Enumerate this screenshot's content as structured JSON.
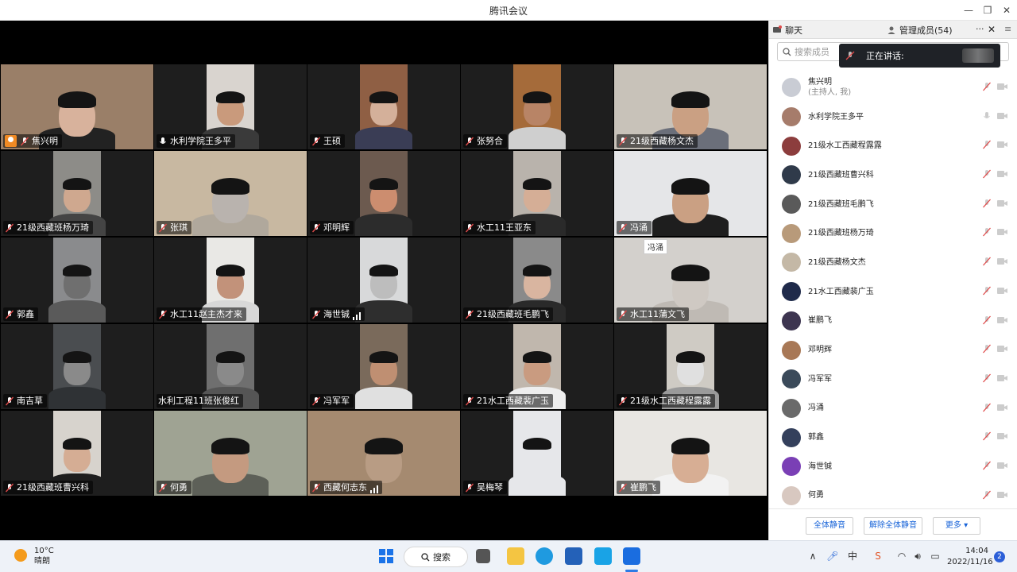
{
  "window": {
    "title": "腾讯会议"
  },
  "tiles": [
    {
      "name": "焦兴明",
      "host": true,
      "mic": "muted",
      "bg": "#9a7f68",
      "pic_l": 0,
      "pic_w": 192,
      "skin": "#d8b29c",
      "cloth": "#222"
    },
    {
      "name": "水利学院王多平",
      "mic": "on",
      "bg": "#d9d4cf",
      "pic_l": 66,
      "pic_w": 60,
      "skin": "#c99a7c",
      "cloth": "#3a3a3a"
    },
    {
      "name": "王硕",
      "mic": "muted",
      "bg": "#8f5f44",
      "pic_l": 66,
      "pic_w": 60,
      "skin": "#d4b09a",
      "cloth": "#3a3d55"
    },
    {
      "name": "张努合",
      "mic": "muted",
      "bg": "#a56b3a",
      "pic_l": 66,
      "pic_w": 60,
      "skin": "#b88466",
      "cloth": "#cfcfcf"
    },
    {
      "name": "21级西藏杨文杰",
      "mic": "muted",
      "bg": "#c8c2b9",
      "pic_l": 0,
      "pic_w": 192,
      "skin": "#caa083",
      "cloth": "#6b6f7a"
    },
    {
      "name": "21级西藏班杨万琦",
      "mic": "muted",
      "bg": "#8d8c88",
      "pic_l": 66,
      "pic_w": 60,
      "skin": "#cfa88f",
      "cloth": "#444"
    },
    {
      "name": "张琪",
      "mic": "muted",
      "bg": "#c8b8a1",
      "pic_l": 0,
      "pic_w": 192,
      "skin": "#b9b3ae",
      "cloth": "#b0a89c"
    },
    {
      "name": "邓明辉",
      "mic": "muted",
      "bg": "#6c5a4f",
      "pic_l": 66,
      "pic_w": 60,
      "skin": "#cc8d6f",
      "cloth": "#2c2c2c"
    },
    {
      "name": "水工11王亚东",
      "mic": "muted",
      "bg": "#b9b3ac",
      "pic_l": 66,
      "pic_w": 60,
      "skin": "#d5ae96",
      "cloth": "#2a2a2a"
    },
    {
      "name": "冯涌",
      "mic": "muted",
      "bg": "#e5e6e8",
      "pic_l": 0,
      "pic_w": 192,
      "skin": "#caa083",
      "cloth": "#1e1e1e"
    },
    {
      "name": "郭鑫",
      "mic": "muted",
      "bg": "#8a8b8d",
      "pic_l": 66,
      "pic_w": 60,
      "skin": "#6f6f6f",
      "cloth": "#5a5a5a"
    },
    {
      "name": "水工11赵主杰才来",
      "mic": "muted",
      "bg": "#e9e8e5",
      "pic_l": 66,
      "pic_w": 60,
      "skin": "#c2927a",
      "cloth": "#d8d8d8"
    },
    {
      "name": "海世铖",
      "mic": "muted",
      "bg": "#d8d9da",
      "pic_l": 66,
      "pic_w": 60,
      "skin": "#bdbdbd",
      "cloth": "#2e2e2e",
      "signal": true
    },
    {
      "name": "21级西藏班毛鹏飞",
      "mic": "muted",
      "bg": "#8a8a8a",
      "pic_l": 66,
      "pic_w": 60,
      "skin": "#d9b5a0",
      "cloth": "#2a2a2a"
    },
    {
      "name": "水工11蒲文飞",
      "mic": "muted",
      "bg": "#d3d0cc",
      "pic_l": 0,
      "pic_w": 192,
      "skin": "#cfc9c3",
      "cloth": "#bfbab4"
    },
    {
      "name": "南吉草",
      "mic": "muted",
      "bg": "#4a4d50",
      "pic_l": 66,
      "pic_w": 60,
      "skin": "#8a8a8a",
      "cloth": "#2f3235"
    },
    {
      "name": "水利工程11班张俊红",
      "mic": "none",
      "bg": "#6f6f6f",
      "pic_l": 66,
      "pic_w": 60,
      "skin": "#8a8a8a",
      "cloth": "#555"
    },
    {
      "name": "冯军军",
      "mic": "muted",
      "bg": "#7a6a5b",
      "pic_l": 66,
      "pic_w": 60,
      "skin": "#bf8f72",
      "cloth": "#e0e0e0"
    },
    {
      "name": "21水工西藏裴广玉",
      "mic": "muted",
      "bg": "#c0b7ad",
      "pic_l": 66,
      "pic_w": 60,
      "skin": "#c99b80",
      "cloth": "#eeeeee"
    },
    {
      "name": "21级水工西藏程露露",
      "mic": "muted",
      "bg": "#cfcbc4",
      "pic_l": 66,
      "pic_w": 60,
      "skin": "#e0e0e0",
      "cloth": "#9a9a9a"
    },
    {
      "name": "21级西藏班曹兴科",
      "mic": "muted",
      "bg": "#d7d3cd",
      "pic_l": 66,
      "pic_w": 60,
      "skin": "#d5ad94",
      "cloth": "#1e1e1e"
    },
    {
      "name": "何勇",
      "mic": "muted",
      "bg": "#9fa393",
      "pic_l": 0,
      "pic_w": 192,
      "skin": "#c49a80",
      "cloth": "#5d6058"
    },
    {
      "name": "西藏何志东",
      "mic": "muted",
      "bg": "#a58a70",
      "pic_l": 0,
      "pic_w": 192,
      "skin": "#b89c84",
      "cloth": "#a58a70",
      "signal": true
    },
    {
      "name": "吴梅琴",
      "mic": "muted",
      "bg": "#e6e7ea",
      "pic_l": 66,
      "pic_w": 60,
      "skin": "#e6e7ea",
      "cloth": "#e6e7ea"
    },
    {
      "name": "崔鹏飞",
      "mic": "muted",
      "bg": "#e8e6e2",
      "pic_l": 0,
      "pic_w": 192,
      "skin": "#d7ae94",
      "cloth": "#f2f2f2"
    }
  ],
  "tooltip": "冯涌",
  "panel": {
    "tab_chat": "聊天",
    "tab_members": "管理成员(54)",
    "more": "···",
    "search_placeholder": "搜索成员",
    "speaking_label": "正在讲话:",
    "members": [
      {
        "name": "焦兴明",
        "sub": "(主持人, 我)",
        "avatar": "#c9ccd4",
        "mic": "muted"
      },
      {
        "name": "水利学院王多平",
        "avatar": "#a67c6b",
        "mic": "on"
      },
      {
        "name": "21级水工西藏程露露",
        "avatar": "#8c3d3d",
        "mic": "muted"
      },
      {
        "name": "21级西藏班曹兴科",
        "avatar": "#2f3a4a",
        "mic": "muted"
      },
      {
        "name": "21级西藏班毛鹏飞",
        "avatar": "#5a5a5a",
        "mic": "muted"
      },
      {
        "name": "21级西藏班杨万琦",
        "avatar": "#b89a7a",
        "mic": "muted"
      },
      {
        "name": "21级西藏杨文杰",
        "avatar": "#c4b8a6",
        "mic": "muted"
      },
      {
        "name": "21水工西藏裴广玉",
        "avatar": "#1f2a4a",
        "mic": "muted"
      },
      {
        "name": "崔鹏飞",
        "avatar": "#3d3550",
        "mic": "muted"
      },
      {
        "name": "邓明辉",
        "avatar": "#a87856",
        "mic": "muted"
      },
      {
        "name": "冯军军",
        "avatar": "#3b4a5a",
        "mic": "muted"
      },
      {
        "name": "冯涌",
        "avatar": "#6a6a6a",
        "mic": "muted"
      },
      {
        "name": "郭鑫",
        "avatar": "#34405c",
        "mic": "muted"
      },
      {
        "name": "海世铖",
        "avatar": "#7a3fb5",
        "mic": "muted"
      },
      {
        "name": "何勇",
        "avatar": "#d8c8c0",
        "mic": "muted"
      }
    ],
    "mute_all": "全体静音",
    "unmute_all": "解除全体静音",
    "more_btn": "更多 ▾"
  },
  "taskbar": {
    "temp": "10°C",
    "weather": "晴朗",
    "search": "搜索",
    "time": "14:04",
    "date": "2022/11/16",
    "notifications": "2"
  },
  "colors": {
    "accent": "#1763d8",
    "muted": "#e04a4a"
  }
}
